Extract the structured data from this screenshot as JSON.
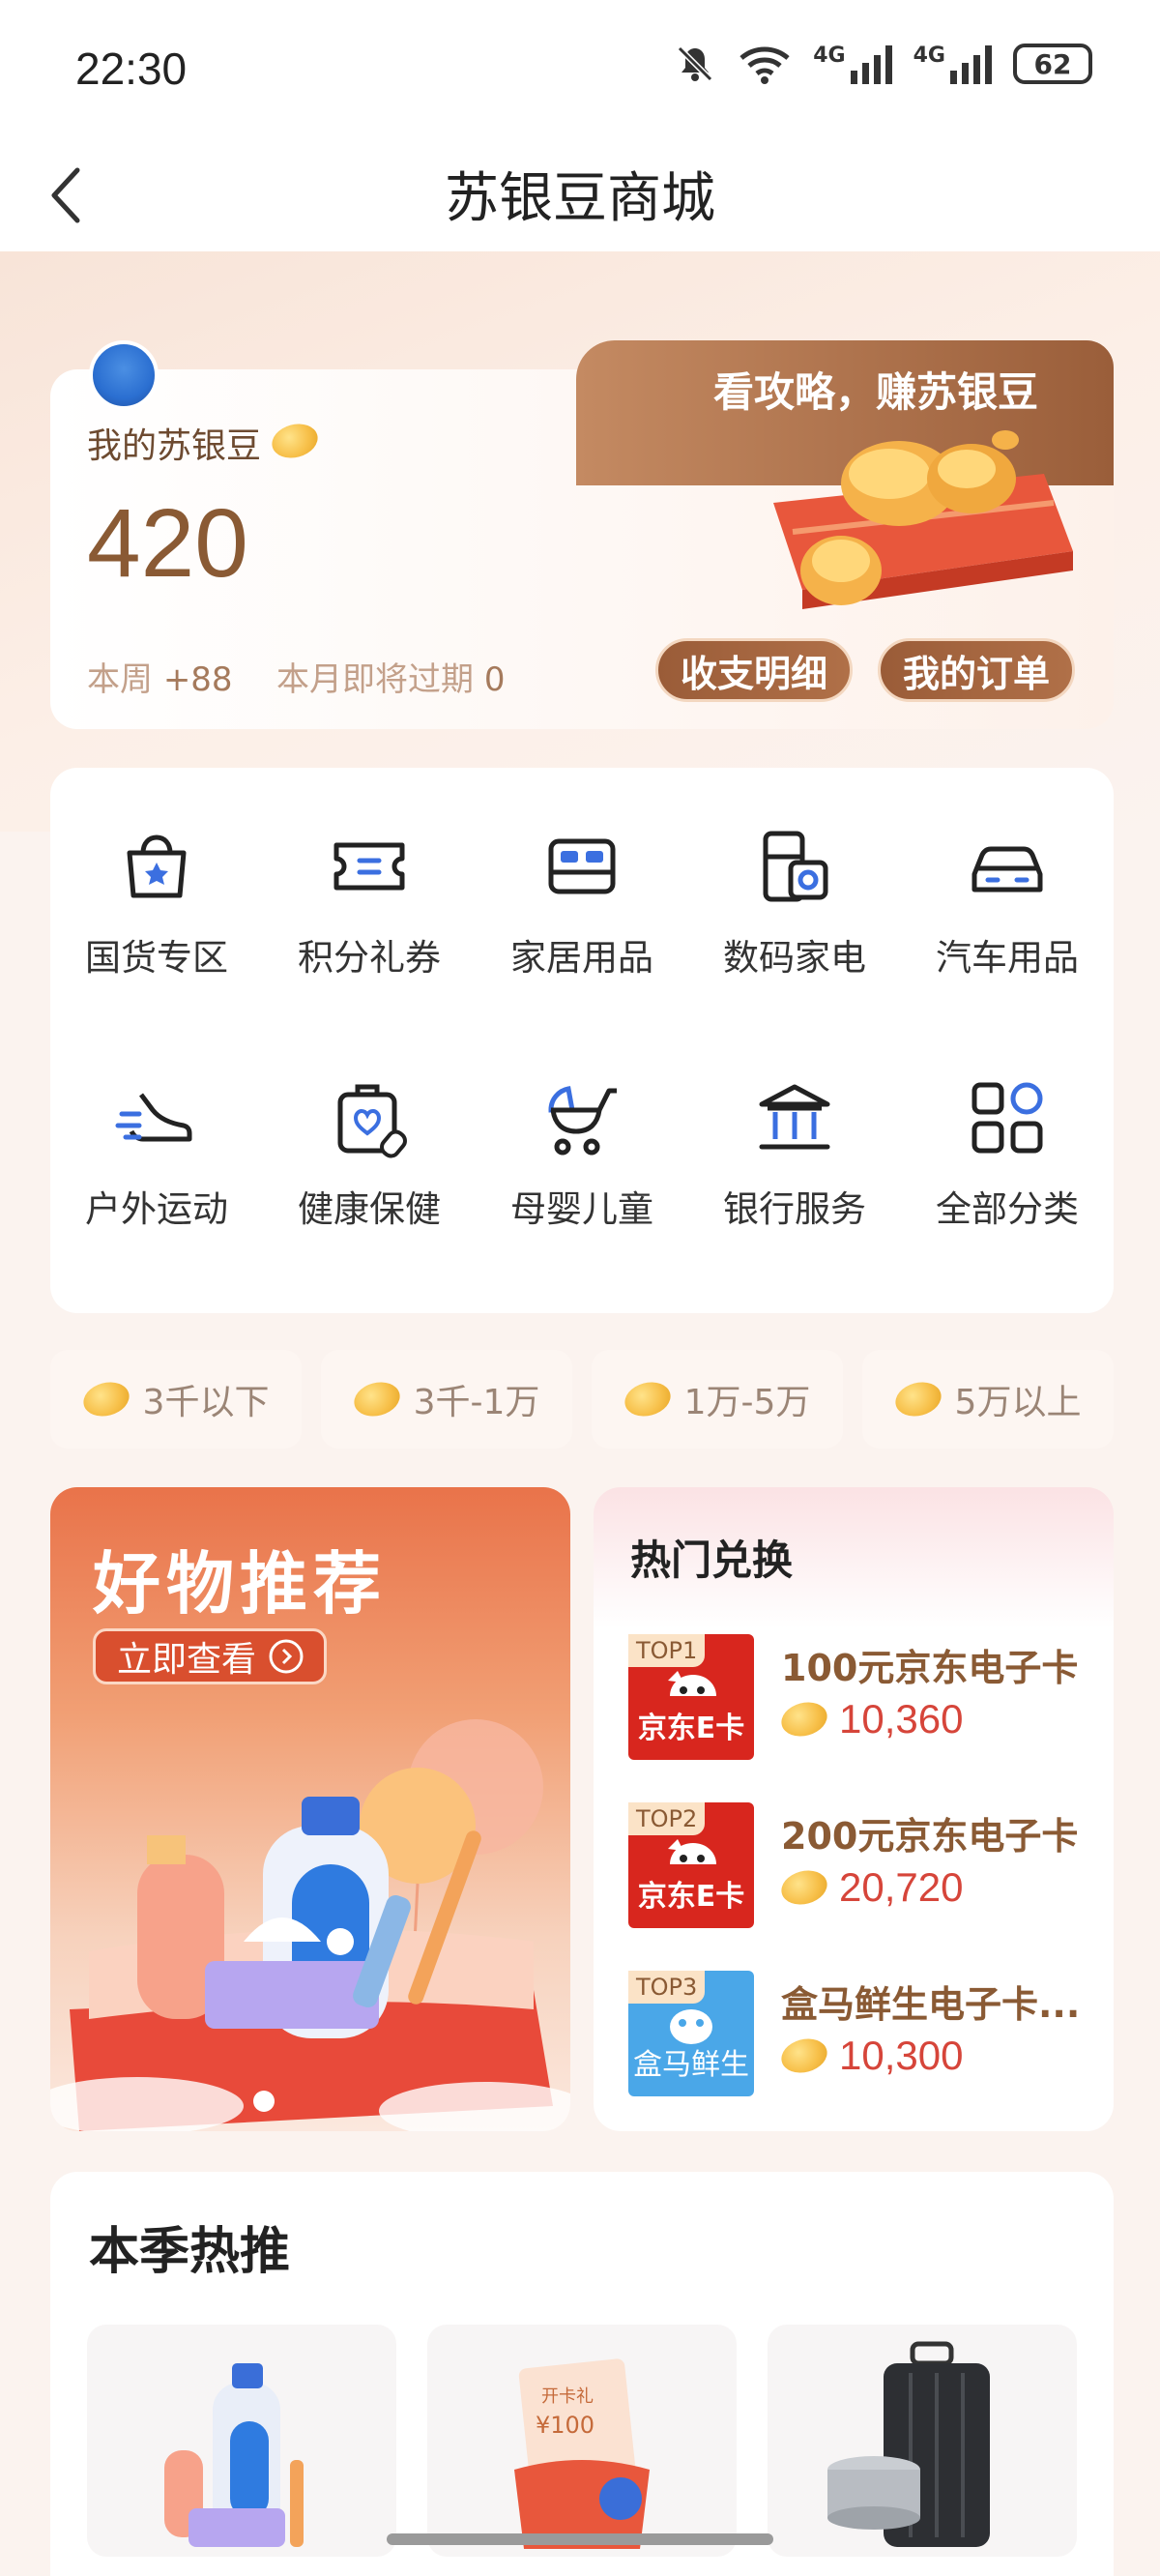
{
  "status_bar": {
    "time": "22:30",
    "network_1": "4G",
    "network_2": "4G",
    "battery": "62"
  },
  "nav": {
    "title": "苏银豆商城"
  },
  "wallet": {
    "avatar_label": "user-avatar",
    "label": "我的苏银豆",
    "balance": "420",
    "week_label": "本周",
    "week_value": "+88",
    "expire_label": "本月即将过期",
    "expire_value": "0",
    "banner_text": "看攻略，赚苏银豆",
    "btn_detail": "收支明细",
    "btn_orders": "我的订单"
  },
  "categories": [
    {
      "label": "国货专区",
      "icon": "shopping-bag-star-icon"
    },
    {
      "label": "积分礼券",
      "icon": "coupon-ticket-icon"
    },
    {
      "label": "家居用品",
      "icon": "bed-icon"
    },
    {
      "label": "数码家电",
      "icon": "fridge-appliance-icon"
    },
    {
      "label": "汽车用品",
      "icon": "car-icon"
    },
    {
      "label": "户外运动",
      "icon": "sneaker-icon"
    },
    {
      "label": "健康保健",
      "icon": "medical-kit-icon"
    },
    {
      "label": "母婴儿童",
      "icon": "baby-stroller-icon"
    },
    {
      "label": "银行服务",
      "icon": "bank-building-icon"
    },
    {
      "label": "全部分类",
      "icon": "grid-all-icon"
    }
  ],
  "price_filters": [
    "3千以下",
    "3千-1万",
    "1万-5万",
    "5万以上"
  ],
  "promo": {
    "title": "好物推荐",
    "button": "立即查看"
  },
  "hot_exchange": {
    "title": "热门兑换",
    "items": [
      {
        "rank": "TOP1",
        "logo": "京东E卡",
        "name": "100元京东电子卡",
        "price": "10,360"
      },
      {
        "rank": "TOP2",
        "logo": "京东E卡",
        "name": "200元京东电子卡",
        "price": "20,720"
      },
      {
        "rank": "TOP3",
        "logo": "盒马鲜生",
        "name": "盒马鲜生电子卡...",
        "price": "10,300"
      }
    ]
  },
  "season": {
    "title": "本季热推",
    "card_text": "开卡礼",
    "card_amount": "¥100"
  },
  "colors": {
    "brand_brown": "#8a5a34",
    "accent_red": "#d6453a",
    "promo_orange": "#e9734a"
  }
}
